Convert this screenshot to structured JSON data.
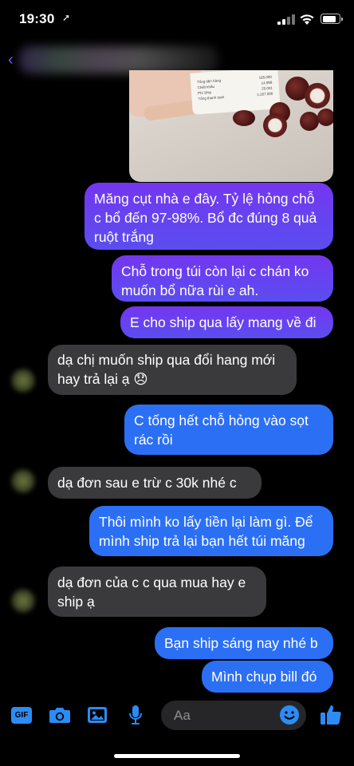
{
  "status_bar": {
    "time": "19:30",
    "location_icon": "location-arrow-icon",
    "signal_icon": "cellular-signal-icon",
    "wifi_icon": "wifi-icon",
    "battery_icon": "battery-icon",
    "battery_level": 0.85
  },
  "header": {
    "back_icon": "chevron-left-icon",
    "contact_name_visible": false
  },
  "receipt": {
    "rows": [
      {
        "label": "Tổng tiền hàng",
        "value": "195.000"
      },
      {
        "label": "Chiết khấu",
        "value": "14.999"
      },
      {
        "label": "Phí Ship",
        "value": "25.001"
      },
      {
        "label": "Tổng thanh toán",
        "value": "1.207.000"
      }
    ]
  },
  "messages": [
    {
      "side": "sent",
      "text": "Măng cụt nhà e đây. Tỷ lệ hỏng chỗ c bổ đến 97-98%. Bổ đc đúng 8 quả ruột trắng"
    },
    {
      "side": "sent",
      "text": "Chỗ trong túi còn lại c chán ko muốn bổ nữa rùi e ah."
    },
    {
      "side": "sent",
      "text": "E cho ship qua lấy mang về đi"
    },
    {
      "side": "received",
      "text": "dạ chị muốn ship qua đổi hang mới hay trả lại ạ 😞"
    },
    {
      "side": "sent",
      "text": "C tống hết chỗ hỏng vào sọt rác rồi"
    },
    {
      "side": "received",
      "text": "dạ đơn sau e trừ c 30k nhé c"
    },
    {
      "side": "sent",
      "text": "Thôi mình ko lấy tiền lại làm gì. Để mình ship trả lại bạn hết túi măng"
    },
    {
      "side": "received",
      "text": "dạ đơn của c c qua mua hay e ship ạ"
    },
    {
      "side": "sent",
      "text": "Bạn ship sáng nay nhé b"
    },
    {
      "side": "sent",
      "text": "Mình chụp bill đó"
    }
  ],
  "composer": {
    "gif_label": "GIF",
    "placeholder": "Aa",
    "icons": [
      "gif-icon",
      "camera-icon",
      "image-icon",
      "microphone-icon",
      "emoji-icon",
      "thumbs-up-icon"
    ]
  },
  "colors": {
    "background": "#000000",
    "sent_purple": "#6a43f0",
    "sent_blue": "#2b6ff5",
    "received_gray": "#3a3a3c",
    "accent": "#2b8cf5"
  }
}
